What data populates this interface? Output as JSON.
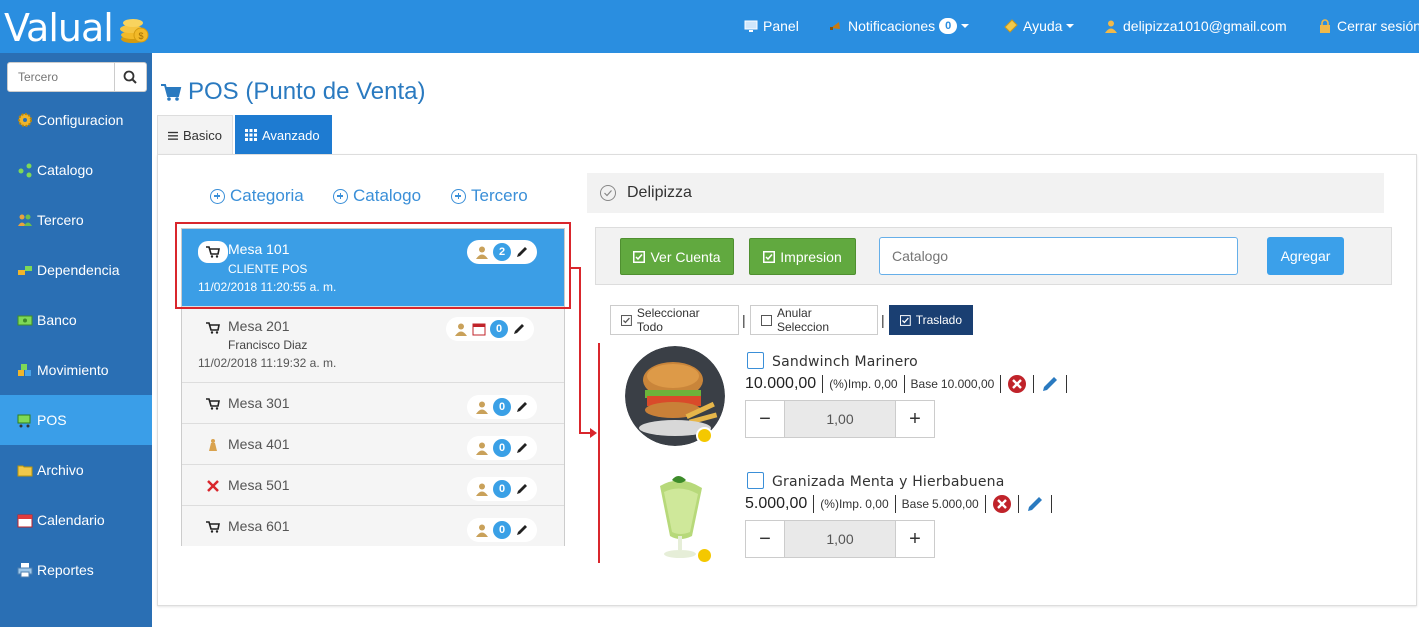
{
  "topbar": {
    "logo_text": "Valual",
    "nav": [
      {
        "label": "Panel",
        "icon": "monitor-icon"
      },
      {
        "label": "Notificaciones",
        "count": "0",
        "icon": "megaphone-icon"
      },
      {
        "label": "Ayuda",
        "icon": "ticket-icon"
      },
      {
        "label": "delipizza1010@gmail.com",
        "icon": "user-icon"
      },
      {
        "label": "Cerrar sesión",
        "icon": "lock-icon"
      }
    ]
  },
  "sidebar": {
    "search_placeholder": "Tercero",
    "items": [
      {
        "label": "Configuracion",
        "icon": "gear-icon"
      },
      {
        "label": "Catalogo",
        "icon": "network-icon"
      },
      {
        "label": "Tercero",
        "icon": "users-icon"
      },
      {
        "label": "Dependencia",
        "icon": "blocks-icon"
      },
      {
        "label": "Banco",
        "icon": "money-icon"
      },
      {
        "label": "Movimiento",
        "icon": "boxes-icon"
      },
      {
        "label": "POS",
        "icon": "cart-icon",
        "active": true
      },
      {
        "label": "Archivo",
        "icon": "folder-icon"
      },
      {
        "label": "Calendario",
        "icon": "calendar-icon"
      },
      {
        "label": "Reportes",
        "icon": "printer-icon"
      }
    ]
  },
  "page": {
    "title": "POS (Punto de Venta)",
    "tabs": [
      {
        "label": "Basico"
      },
      {
        "label": "Avanzado",
        "active": true
      }
    ]
  },
  "links": {
    "categoria": "Categoria",
    "catalogo": "Catalogo",
    "tercero": "Tercero"
  },
  "mesas": [
    {
      "name": "Mesa 101",
      "client": "CLIENTE POS",
      "date": "11/02/2018 11:20:55 a. m.",
      "count": "2",
      "active": true
    },
    {
      "name": "Mesa 201",
      "client": "Francisco Diaz",
      "date": "11/02/2018 11:19:32 a. m.",
      "count": "0"
    },
    {
      "name": "Mesa 301",
      "count": "0"
    },
    {
      "name": "Mesa 401",
      "count": "0"
    },
    {
      "name": "Mesa 501",
      "count": "0"
    },
    {
      "name": "Mesa 601",
      "count": "0"
    }
  ],
  "store": {
    "name": "Delipizza"
  },
  "actions": {
    "ver_cuenta": "Ver Cuenta",
    "impresion": "Impresion",
    "catalog_placeholder": "Catalogo",
    "agregar": "Agregar"
  },
  "selection": {
    "seleccionar_todo": "Seleccionar Todo",
    "anular": "Anular Seleccion",
    "traslado": "Traslado"
  },
  "products": [
    {
      "name": "Sandwinch Marinero",
      "price": "10.000,00",
      "imp_label": "(%)Imp.",
      "imp": "0,00",
      "base_label": "Base",
      "base": "10.000,00",
      "qty": "1,00"
    },
    {
      "name": "Granizada Menta y Hierbabuena",
      "price": "5.000,00",
      "imp_label": "(%)Imp.",
      "imp": "0,00",
      "base_label": "Base",
      "base": "5.000,00",
      "qty": "1,00"
    }
  ]
}
